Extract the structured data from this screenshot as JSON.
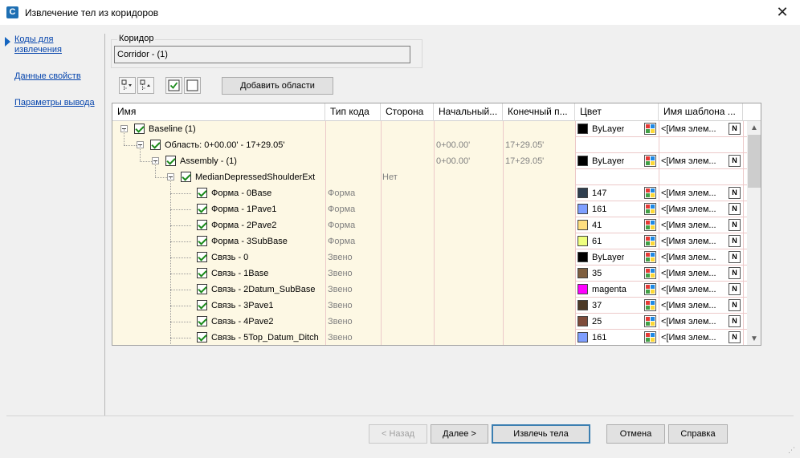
{
  "window": {
    "title": "Извлечение тел из коридоров",
    "close_glyph": "✕"
  },
  "nav": {
    "items": [
      {
        "label": "Коды для извлечения",
        "selected": true
      },
      {
        "label": "Данные свойств",
        "selected": false
      },
      {
        "label": "Параметры вывода",
        "selected": false
      }
    ]
  },
  "corridor": {
    "legend": "Коридор",
    "value": "Corridor - (1)"
  },
  "toolbar": {
    "add_regions_label": "Добавить области"
  },
  "grid": {
    "columns": [
      "Имя",
      "Тип кода",
      "Сторона",
      "Начальный...",
      "Конечный п...",
      "Цвет",
      "Имя шаблона ..."
    ],
    "rows": [
      {
        "name": "Baseline (1)",
        "level": 0,
        "expandable": true,
        "code_type": "",
        "side": "",
        "start": "",
        "end": "",
        "color_name": "ByLayer",
        "color_hex": "#000000",
        "template": "<[Имя элем..."
      },
      {
        "name": "Область: 0+00.00' - 17+29.05'",
        "level": 1,
        "expandable": true,
        "code_type": "",
        "side": "",
        "start": "0+00.00'",
        "end": "17+29.05'",
        "color_name": "",
        "color_hex": "",
        "template": ""
      },
      {
        "name": "Assembly - (1)",
        "level": 2,
        "expandable": true,
        "code_type": "",
        "side": "",
        "start": "0+00.00'",
        "end": "17+29.05'",
        "color_name": "ByLayer",
        "color_hex": "#000000",
        "template": "<[Имя элем..."
      },
      {
        "name": "MedianDepressedShoulderExt",
        "level": 3,
        "expandable": true,
        "code_type": "",
        "side": "Нет",
        "start": "",
        "end": "",
        "color_name": "",
        "color_hex": "",
        "template": ""
      },
      {
        "name": "Форма - 0Base",
        "level": 4,
        "expandable": false,
        "code_type": "Форма",
        "side": "",
        "start": "",
        "end": "",
        "color_name": "147",
        "color_hex": "#2f3f4f",
        "template": "<[Имя элем..."
      },
      {
        "name": "Форма - 1Pave1",
        "level": 4,
        "expandable": false,
        "code_type": "Форма",
        "side": "",
        "start": "",
        "end": "",
        "color_name": "161",
        "color_hex": "#7f9fff",
        "template": "<[Имя элем..."
      },
      {
        "name": "Форма - 2Pave2",
        "level": 4,
        "expandable": false,
        "code_type": "Форма",
        "side": "",
        "start": "",
        "end": "",
        "color_name": "41",
        "color_hex": "#ffdf7f",
        "template": "<[Имя элем..."
      },
      {
        "name": "Форма - 3SubBase",
        "level": 4,
        "expandable": false,
        "code_type": "Форма",
        "side": "",
        "start": "",
        "end": "",
        "color_name": "61",
        "color_hex": "#efff7f",
        "template": "<[Имя элем..."
      },
      {
        "name": "Связь - 0",
        "level": 4,
        "expandable": false,
        "code_type": "Звено",
        "side": "",
        "start": "",
        "end": "",
        "color_name": "ByLayer",
        "color_hex": "#000000",
        "template": "<[Имя элем..."
      },
      {
        "name": "Связь - 1Base",
        "level": 4,
        "expandable": false,
        "code_type": "Звено",
        "side": "",
        "start": "",
        "end": "",
        "color_name": "35",
        "color_hex": "#7f5f3f",
        "template": "<[Имя элем..."
      },
      {
        "name": "Связь - 2Datum_SubBase",
        "level": 4,
        "expandable": false,
        "code_type": "Звено",
        "side": "",
        "start": "",
        "end": "",
        "color_name": "magenta",
        "color_hex": "#ff00ff",
        "template": "<[Имя элем..."
      },
      {
        "name": "Связь - 3Pave1",
        "level": 4,
        "expandable": false,
        "code_type": "Звено",
        "side": "",
        "start": "",
        "end": "",
        "color_name": "37",
        "color_hex": "#4c3926",
        "template": "<[Имя элем..."
      },
      {
        "name": "Связь - 4Pave2",
        "level": 4,
        "expandable": false,
        "code_type": "Звено",
        "side": "",
        "start": "",
        "end": "",
        "color_name": "25",
        "color_hex": "#7f4c3a",
        "template": "<[Имя элем..."
      },
      {
        "name": "Связь - 5Top_Datum_Ditch",
        "level": 4,
        "expandable": false,
        "code_type": "Звено",
        "side": "",
        "start": "",
        "end": "",
        "color_name": "161",
        "color_hex": "#7f9fff",
        "template": "<[Имя элем..."
      }
    ]
  },
  "buttons": {
    "back": "< Назад",
    "next": "Далее >",
    "extract": "Извлечь тела",
    "cancel": "Отмена",
    "help": "Справка"
  }
}
